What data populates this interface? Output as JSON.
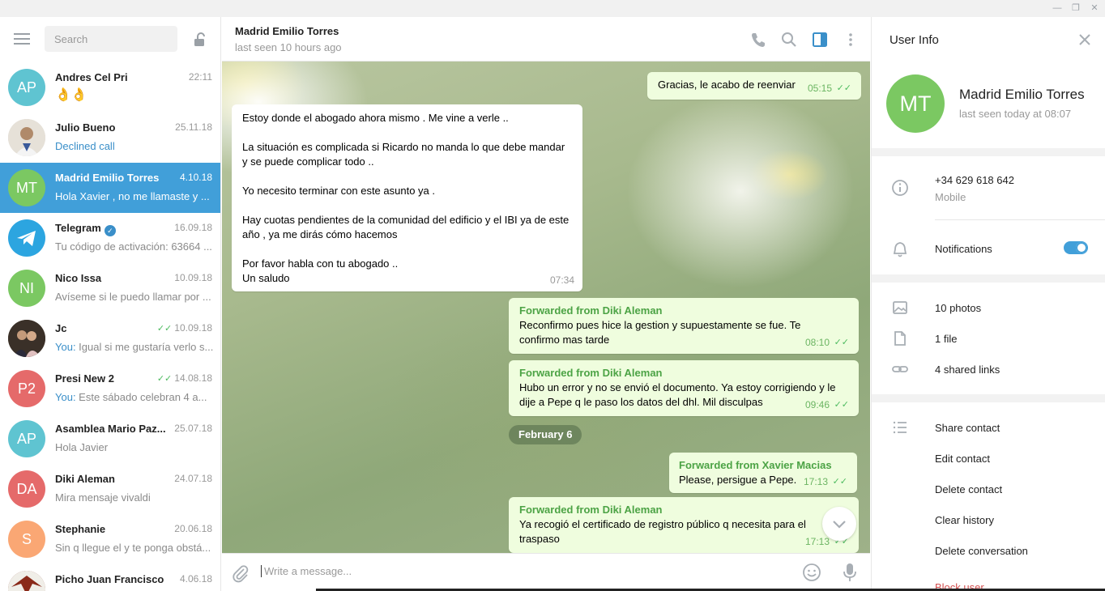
{
  "sidebar": {
    "search_placeholder": "Search",
    "chats": [
      {
        "initials": "AP",
        "color": "#5fc4d1",
        "name": "Andres Cel Pri",
        "date": "22:11",
        "message": "👌👌"
      },
      {
        "initials": "",
        "color": "#c9c4bd",
        "name": "Julio Bueno",
        "date": "25.11.18",
        "message": "Declined call"
      },
      {
        "initials": "MT",
        "color": "#7bc862",
        "name": "Madrid Emilio Torres",
        "date": "4.10.18",
        "message": "Hola Xavier , no me llamaste y ..."
      },
      {
        "initials": "",
        "color": "#2ca5e0",
        "name": "Telegram",
        "date": "16.09.18",
        "message": "Tu código de activación: 63664 ..."
      },
      {
        "initials": "NI",
        "color": "#7bc862",
        "name": "Nico Issa",
        "date": "10.09.18",
        "message": "Avíseme si le puedo llamar por ..."
      },
      {
        "initials": "",
        "color": "#7a6a5a",
        "name": "Jc",
        "date": "10.09.18",
        "you": "You:",
        "message": " Igual si me gustaría verlo s..."
      },
      {
        "initials": "P2",
        "color": "#e56a6a",
        "name": "Presi New 2",
        "date": "14.08.18",
        "you": "You:",
        "message": " Este sábado celebran 4 a..."
      },
      {
        "initials": "AP",
        "color": "#5fc4d1",
        "name": "Asamblea Mario Paz...",
        "date": "25.07.18",
        "message": "Hola Javier"
      },
      {
        "initials": "DA",
        "color": "#e56a6a",
        "name": "Diki Aleman",
        "date": "24.07.18",
        "message": "Mira mensaje vivaldi"
      },
      {
        "initials": "S",
        "color": "#faa774",
        "name": "Stephanie",
        "date": "20.06.18",
        "message": "Sin q llegue el y te ponga obstá..."
      },
      {
        "initials": "",
        "color": "#8a3a2a",
        "name": "Picho Juan Francisco",
        "date": "4.06.18",
        "message": ""
      }
    ]
  },
  "header": {
    "name": "Madrid Emilio Torres",
    "status": "last seen 10 hours ago"
  },
  "messages": {
    "m1": {
      "text": "Gracias, le acabo de reenviar",
      "time": "05:15"
    },
    "m2": {
      "p1": "Estoy donde el abogado  ahora  mismo . Me vine a verle ..",
      "p2": "La situación es complicada si Ricardo no manda lo que debe mandar y se puede complicar todo ..",
      "p3": "Yo necesito terminar con este asunto ya .",
      "p4": "Hay cuotas pendientes de la comunidad del edificio y el IBI ya de este año , ya me dirás cómo hacemos",
      "p5a": "Por favor habla con tu abogado ..",
      "p5b": "Un saludo",
      "time": "07:34"
    },
    "m3": {
      "fwd": "Forwarded from Diki Aleman",
      "text": "Reconfirmo pues hice la gestion y supuestamente se fue. Te confirmo mas tarde",
      "time": "08:10"
    },
    "m4": {
      "fwd": "Forwarded from Diki Aleman",
      "text": "Hubo un error y no se envió el documento. Ya estoy corrigiendo y le dije a Pepe q le paso los datos del dhl. Mil disculpas",
      "time": "09:46"
    },
    "date_separator": "February 6",
    "m5": {
      "fwd": "Forwarded from Xavier Macias",
      "text": "Please, persigue a Pepe.",
      "time": "17:13"
    },
    "m6": {
      "fwd": "Forwarded from Diki Aleman",
      "text": "Ya recogió el certificado de registro público q necesita para el traspaso",
      "time": "17:13"
    }
  },
  "compose": {
    "placeholder": "Write a message..."
  },
  "user_info": {
    "title": "User Info",
    "initials": "MT",
    "name": "Madrid Emilio Torres",
    "status": "last seen today at 08:07",
    "phone": "+34 629 618 642",
    "phone_label": "Mobile",
    "notifications_label": "Notifications",
    "notifications_on": true,
    "media": {
      "photos": "10 photos",
      "files": "1 file",
      "links": "4 shared links"
    },
    "actions": {
      "share": "Share contact",
      "edit": "Edit contact",
      "delete": "Delete contact",
      "clear": "Clear history",
      "delete_conv": "Delete conversation",
      "block": "Block user"
    }
  }
}
